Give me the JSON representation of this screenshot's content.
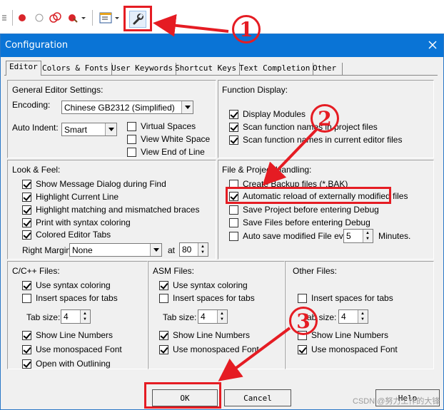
{
  "toolbar": {
    "icons": [
      "breakpoint-icon",
      "disabled-breakpoint-icon",
      "clear-breakpoints-icon",
      "kill-breakpoints-icon",
      "window-layout-icon",
      "configuration-wrench-icon"
    ]
  },
  "dialog": {
    "title": "Configuration",
    "tabs": [
      "Editor",
      "Colors & Fonts",
      "User Keywords",
      "Shortcut Keys",
      "Text Completion",
      "Other"
    ],
    "general": {
      "title": "General Editor Settings:",
      "encoding_label": "Encoding:",
      "encoding_value": "Chinese GB2312 (Simplified)",
      "auto_indent_label": "Auto Indent:",
      "auto_indent_value": "Smart",
      "virtual_spaces": "Virtual Spaces",
      "view_white_space": "View White Space",
      "view_end_of_line": "View End of Line"
    },
    "function_display": {
      "title": "Function Display:",
      "display_modules": "Display Modules",
      "scan_project": "Scan function names in project files",
      "scan_editor": "Scan function names in current editor files"
    },
    "look_feel": {
      "title": "Look & Feel:",
      "items": [
        "Show Message Dialog during Find",
        "Highlight Current Line",
        "Highlight matching and mismatched braces",
        "Print with syntax coloring",
        "Colored Editor Tabs"
      ],
      "right_margin_label": "Right Margin:",
      "right_margin_value": "None",
      "at_label": "at",
      "at_value": "80"
    },
    "file_project": {
      "title": "File & Project Handling:",
      "create_backup": "Create Backup files (*.BAK)",
      "auto_reload": "Automatic reload of externally modified files",
      "save_project": "Save Project before entering Debug",
      "save_files": "Save Files before entering Debug",
      "auto_save": "Auto save modified File every",
      "auto_save_value": "5",
      "minutes": "Minutes."
    },
    "cpp_files": {
      "title": "C/C++ Files:",
      "syntax": "Use syntax coloring",
      "insert_spaces": "Insert spaces for tabs",
      "tab_size_label": "Tab size:",
      "tab_size": "4",
      "line_numbers": "Show Line Numbers",
      "monospaced": "Use monospaced Font",
      "outlining": "Open with Outlining"
    },
    "asm_files": {
      "title": "ASM Files:",
      "syntax": "Use syntax coloring",
      "insert_spaces": "Insert spaces for tabs",
      "tab_size_label": "Tab size:",
      "tab_size": "4",
      "line_numbers": "Show Line Numbers",
      "monospaced": "Use monospaced Font"
    },
    "other_files": {
      "title": "Other Files:",
      "insert_spaces": "Insert spaces for tabs",
      "tab_size_label": "Tab size:",
      "tab_size": "4",
      "line_numbers": "Show Line Numbers",
      "monospaced": "Use monospaced Font"
    },
    "buttons": {
      "ok": "OK",
      "cancel": "Cancel",
      "help": "Help"
    }
  },
  "annotations": {
    "step1": "1",
    "step2": "2",
    "step3": "3",
    "color": "#e51c23"
  },
  "watermark": "CSDN @努力工作的大锋"
}
